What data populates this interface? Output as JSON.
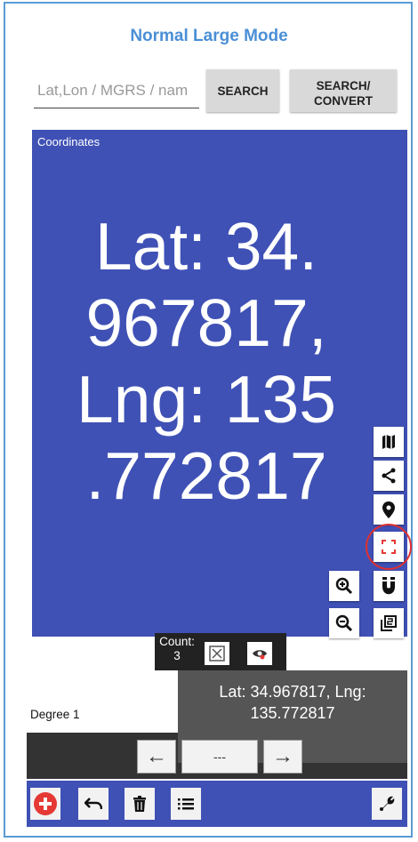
{
  "header": {
    "title": "Normal Large Mode"
  },
  "search": {
    "placeholder": "Lat,Lon / MGRS / nam",
    "search_label": "SEARCH",
    "convert_label": "SEARCH/\nCONVERT"
  },
  "coordinates": {
    "label": "Coordinates",
    "lines": [
      "Lat: 34.",
      "967817,",
      "Lng: 135",
      ".772817"
    ]
  },
  "side_tools": [
    "map-icon",
    "share-icon",
    "pin-icon",
    "fullscreen-icon",
    "zoom-in-icon",
    "magnet-icon",
    "zoom-out-icon",
    "copy-icon"
  ],
  "count": {
    "label": "Count:",
    "value": "3"
  },
  "degree_label": "Degree 1",
  "result": {
    "text": "Lat: 34.967817, Lng: 135.772817"
  },
  "nav": {
    "prev": "←",
    "page": "---",
    "next": "→"
  },
  "colors": {
    "panel": "#3f51b5",
    "accent_title": "#4a8fd6",
    "highlight": "#e03030",
    "add_button": "#e53935"
  }
}
